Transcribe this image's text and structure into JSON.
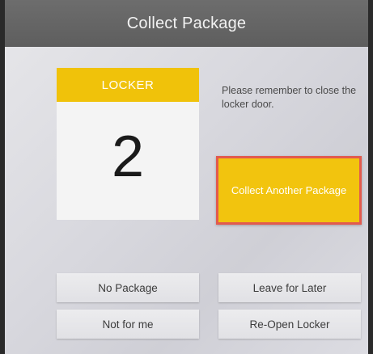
{
  "header": {
    "title": "Collect Package"
  },
  "locker": {
    "label": "LOCKER",
    "number": "2"
  },
  "message": {
    "text": "Please remember to close the locker door."
  },
  "actions": {
    "collect_another": "Collect Another Package",
    "no_package": "No Package",
    "leave_for_later": "Leave for Later",
    "not_for_me": "Not for me",
    "reopen_locker": "Re-Open Locker"
  },
  "colors": {
    "accent_yellow": "#f2c40e",
    "highlight_border": "#e25a4e",
    "titlebar": "#616161"
  }
}
